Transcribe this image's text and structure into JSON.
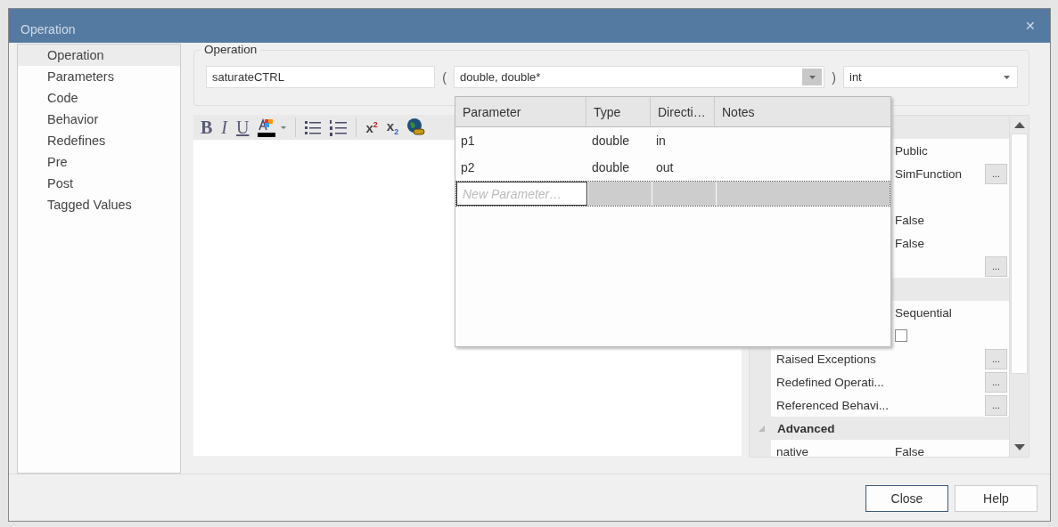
{
  "window": {
    "title": "Operation",
    "close_glyph": "✕"
  },
  "nav": [
    {
      "label": "Operation",
      "selected": true
    },
    {
      "label": "Parameters",
      "selected": false
    },
    {
      "label": "Code",
      "selected": false
    },
    {
      "label": "Behavior",
      "selected": false
    },
    {
      "label": "Redefines",
      "selected": false
    },
    {
      "label": "Pre",
      "selected": false
    },
    {
      "label": "Post",
      "selected": false
    },
    {
      "label": "Tagged Values",
      "selected": false
    }
  ],
  "operation": {
    "group_label": "Operation",
    "name": "saturateCTRL",
    "open_paren": "(",
    "parameters": "double, double*",
    "close_paren": ")",
    "return_type": "int"
  },
  "toolbar": [
    {
      "kind": "bold",
      "glyph": "B"
    },
    {
      "kind": "italic",
      "glyph": "I"
    },
    {
      "kind": "underline",
      "glyph": "U"
    },
    {
      "kind": "color"
    },
    {
      "kind": "bullets"
    },
    {
      "kind": "numbering"
    },
    {
      "kind": "superscript",
      "glyph": "x$^{2}$"
    },
    {
      "kind": "subscript",
      "glyph": "x$_{2}$"
    },
    {
      "kind": "hyperlink"
    }
  ],
  "param_grid": {
    "columns": [
      "Parameter",
      "Type",
      "Directi…",
      "Notes"
    ],
    "rows": [
      {
        "name": "p1",
        "type": "double",
        "direction": "in"
      },
      {
        "name": "p2",
        "type": "double",
        "direction": "out"
      }
    ],
    "new_row": {
      "placeholder": "New Parameter…"
    }
  },
  "properties": [
    {
      "kind": "group"
    },
    {
      "kind": "value",
      "value": "Public"
    },
    {
      "kind": "value",
      "value": "SimFunction",
      "button": "..."
    },
    {
      "kind": "blank"
    },
    {
      "kind": "value",
      "value": "False"
    },
    {
      "kind": "value",
      "value": "False"
    },
    {
      "kind": "value",
      "button": "..."
    },
    {
      "kind": "group"
    },
    {
      "kind": "value",
      "value": "Sequential"
    },
    {
      "kind": "checkbox",
      "checked": false
    },
    {
      "kind": "value",
      "name": "Raised Exceptions",
      "button": "..."
    },
    {
      "kind": "value",
      "name": "Redefined Operati...",
      "button": "..."
    },
    {
      "kind": "value",
      "name": "Referenced Behavi...",
      "button": "..."
    },
    {
      "kind": "group",
      "label": "Advanced"
    },
    {
      "kind": "value",
      "name": "native",
      "value": "False"
    }
  ],
  "buttons": [
    {
      "label": "Close",
      "default": true
    },
    {
      "label": "Help",
      "default": false
    }
  ]
}
